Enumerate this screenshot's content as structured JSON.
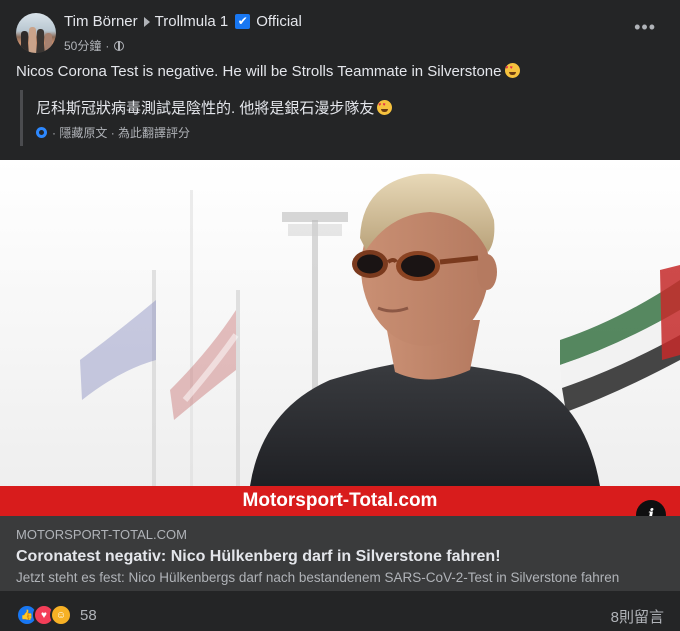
{
  "post": {
    "author": "Tim Börner",
    "group": "Trollmula 1",
    "group_tag": "Official",
    "time": "50分鐘",
    "more_label": "•••",
    "text": "Nicos Corona Test is negative. He will be Strolls Teammate in Silverstone",
    "translation": "尼科斯冠狀病毒測試是陰性的. 他將是銀石漫步隊友",
    "hide_original": "隱藏原文",
    "rate_translation": "為此翻譯評分"
  },
  "image": {
    "watermark": "Motorsport-Total.com",
    "info_label": "i"
  },
  "link": {
    "domain": "MOTORSPORT-TOTAL.COM",
    "title": "Coronatest negativ: Nico Hülkenberg darf in Silverstone fahren!",
    "description": "Jetzt steht es fest: Nico Hülkenbergs darf nach bestandenem SARS-CoV-2-Test in Silverstone fahren"
  },
  "footer": {
    "reaction_count": "58",
    "comments": "8則留言"
  },
  "colors": {
    "background": "#242526",
    "link_box": "#3a3b3c",
    "brand_red": "#d81c1c",
    "verified": "#1877f2"
  }
}
